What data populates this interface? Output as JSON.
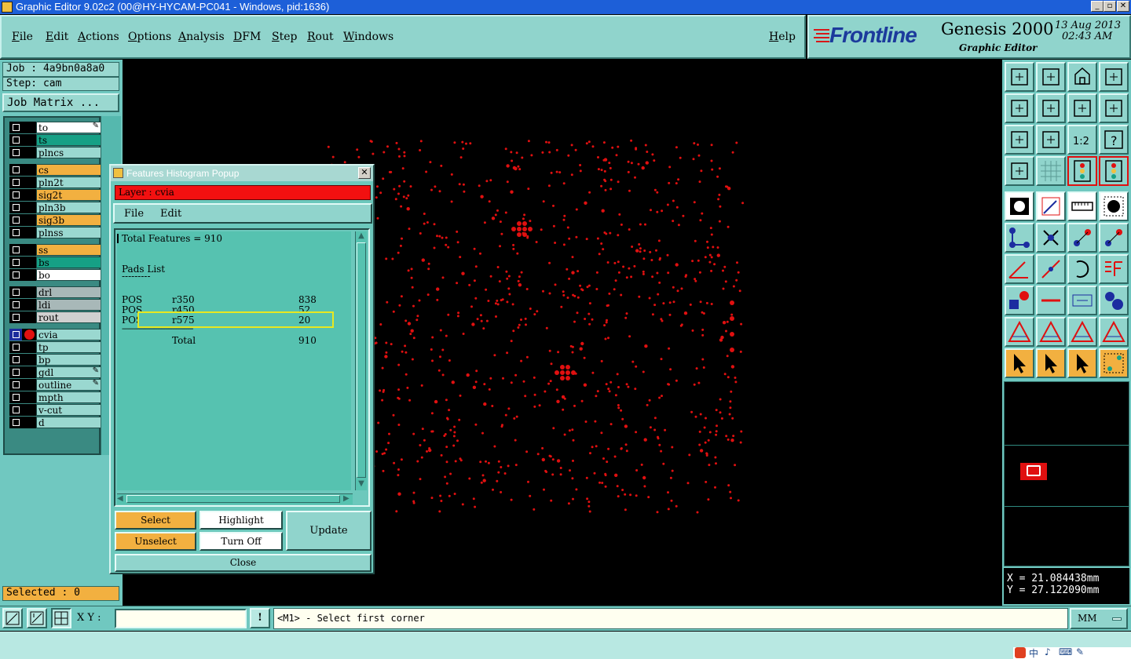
{
  "window": {
    "title": "Graphic Editor 9.02c2 (00@HY-HYCAM-PC041 - Windows, pid:1636)",
    "min_glyph": "_",
    "max_glyph": "▫",
    "close_glyph": "✕"
  },
  "menu": {
    "items": [
      "File",
      "Edit",
      "Actions",
      "Options",
      "Analysis",
      "DFM",
      "Step",
      "Rout",
      "Windows"
    ],
    "help": "Help"
  },
  "logo": {
    "brand": "Frontline",
    "product": "Genesis 2000",
    "subtitle": "Graphic Editor",
    "date": "13 Aug 2013",
    "time": "02:43 AM"
  },
  "left": {
    "job": "Job : 4a9bn0a8a0",
    "step": "Step: cam",
    "job_matrix": "Job Matrix ...",
    "selected": "Selected : 0"
  },
  "layers": [
    {
      "name": "to",
      "color": "#ffffff",
      "mark": "pencil"
    },
    {
      "name": "ts",
      "color": "#16a085"
    },
    {
      "name": "plncs",
      "color": "#9ad8d0"
    },
    {
      "name": "cs",
      "color": "#f2b040"
    },
    {
      "name": "pln2t",
      "color": "#9ad8d0"
    },
    {
      "name": "sig2t",
      "color": "#f2b040"
    },
    {
      "name": "pln3b",
      "color": "#9ad8d0"
    },
    {
      "name": "sig3b",
      "color": "#f2b040"
    },
    {
      "name": "plnss",
      "color": "#9ad8d0"
    },
    {
      "name": "ss",
      "color": "#f2b040"
    },
    {
      "name": "bs",
      "color": "#16a085"
    },
    {
      "name": "bo",
      "color": "#ffffff"
    },
    {
      "name": "drl",
      "color": "#a8b8b8"
    },
    {
      "name": "ldi",
      "color": "#a8b8b8"
    },
    {
      "name": "rout",
      "color": "#d0d0d0"
    },
    {
      "name": "cvia",
      "color": "#9ad8d0",
      "active": true
    },
    {
      "name": "tp",
      "color": "#9ad8d0"
    },
    {
      "name": "bp",
      "color": "#9ad8d0"
    },
    {
      "name": "gdl",
      "color": "#9ad8d0",
      "mark": "pencil"
    },
    {
      "name": "outline",
      "color": "#9ad8d0",
      "mark": "pencil"
    },
    {
      "name": "mpth",
      "color": "#9ad8d0"
    },
    {
      "name": "v-cut",
      "color": "#9ad8d0"
    },
    {
      "name": "d",
      "color": "#9ad8d0"
    }
  ],
  "popup": {
    "title": "Features Histogram Popup",
    "layer_label": "Layer :  cvia",
    "menu_file": "File",
    "menu_edit": "Edit",
    "total_features": "Total Features = 910",
    "section": "Pads List",
    "underline": "---------",
    "rows": [
      {
        "type": "POS",
        "sym": "r350",
        "count": "838"
      },
      {
        "type": "POS",
        "sym": "r450",
        "count": "52"
      },
      {
        "type": "POS",
        "sym": "r575",
        "count": "20"
      }
    ],
    "divider": "--------------------------------------",
    "total_label": "Total",
    "total_value": "910",
    "select": "Select",
    "unselect": "Unselect",
    "highlight": "Highlight",
    "turn_off": "Turn Off",
    "update": "Update",
    "close": "Close"
  },
  "coords": {
    "x": "X = 21.084438mm",
    "y": "Y = 27.122090mm"
  },
  "bottom": {
    "xy_label": "X Y :",
    "xy_value": "",
    "bang": "!",
    "prompt": "<M1> - Select first corner",
    "units": "MM"
  },
  "tray": {
    "items": [
      "中",
      "♪",
      "⌨",
      "✎"
    ]
  },
  "colors": {
    "pad_red": "#e01010",
    "panel_teal": "#70c8c0",
    "highlight_yellow": "#e8e820"
  }
}
